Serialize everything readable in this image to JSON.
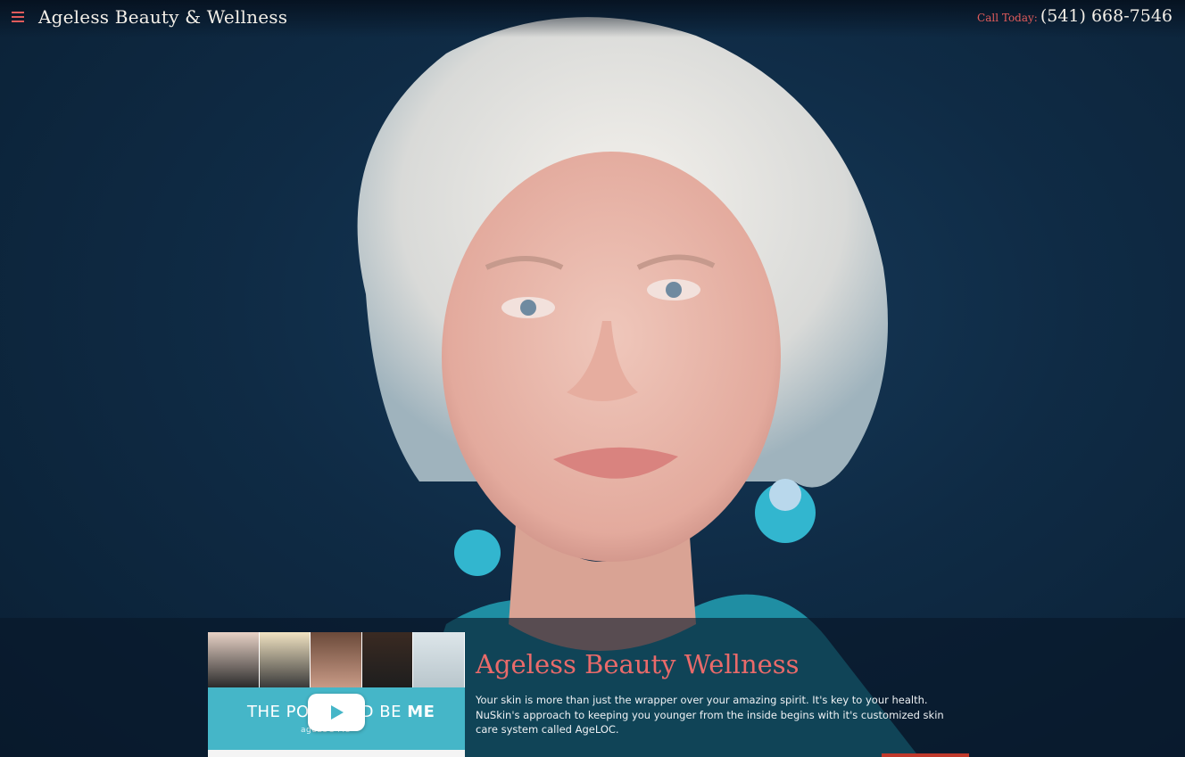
{
  "header": {
    "title": "Ageless Beauty & Wellness",
    "call_label": "Call Today:",
    "phone": "(541) 668-7546",
    "menu_icon": "hamburger-menu-icon"
  },
  "intro": {
    "heading": "Ageless Beauty Wellness",
    "body": "Your skin is more than just the wrapper over your amazing spirit. It's key to your health. NuSkin's approach to keeping you younger from the inside begins with it's customized skin care system called AgeLOC."
  },
  "video_thumbnail": {
    "tagline_prefix": "THE PO",
    "tagline_mid": "D BE ",
    "tagline_bold": "ME",
    "sub": "ageLOC Me",
    "play_icon": "play-icon"
  },
  "colors": {
    "accent": "#e05b5b",
    "heading": "#e96a6a",
    "teal": "#45b6c8",
    "background": "#0f2b45"
  }
}
